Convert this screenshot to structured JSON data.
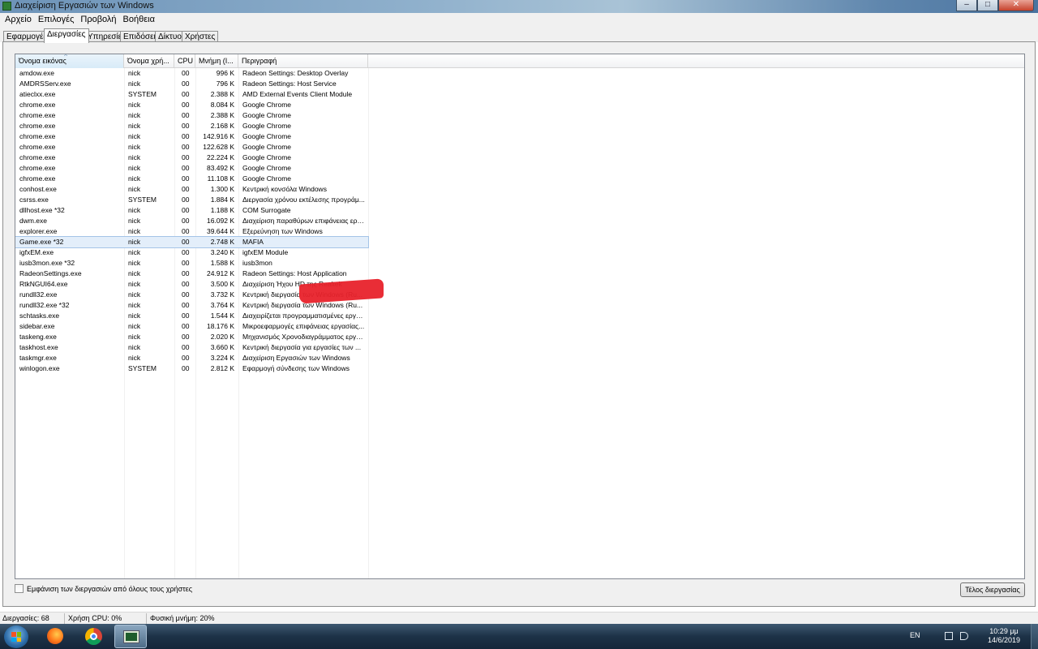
{
  "window": {
    "title": "Διαχείριση Εργασιών των Windows"
  },
  "menu": [
    "Αρχείο",
    "Επιλογές",
    "Προβολή",
    "Βοήθεια"
  ],
  "tabs": [
    "Εφαρμογές",
    "Διεργασίες",
    "Υπηρεσίες",
    "Επιδόσεις",
    "Δίκτυο",
    "Χρήστες"
  ],
  "active_tab": "Διεργασίες",
  "columns": {
    "image_name": "Όνομα εικόνας",
    "user_name": "Όνομα χρή...",
    "cpu": "CPU",
    "memory": "Μνήμη (Ι...",
    "description": "Περιγραφή"
  },
  "processes": [
    {
      "name": "amdow.exe",
      "user": "nick",
      "cpu": "00",
      "mem": "996 K",
      "desc": "Radeon Settings: Desktop Overlay"
    },
    {
      "name": "AMDRSServ.exe",
      "user": "nick",
      "cpu": "00",
      "mem": "796 K",
      "desc": "Radeon Settings: Host Service"
    },
    {
      "name": "atieclxx.exe",
      "user": "SYSTEM",
      "cpu": "00",
      "mem": "2.388 K",
      "desc": "AMD External Events Client Module"
    },
    {
      "name": "chrome.exe",
      "user": "nick",
      "cpu": "00",
      "mem": "8.084 K",
      "desc": "Google Chrome"
    },
    {
      "name": "chrome.exe",
      "user": "nick",
      "cpu": "00",
      "mem": "2.388 K",
      "desc": "Google Chrome"
    },
    {
      "name": "chrome.exe",
      "user": "nick",
      "cpu": "00",
      "mem": "2.168 K",
      "desc": "Google Chrome"
    },
    {
      "name": "chrome.exe",
      "user": "nick",
      "cpu": "00",
      "mem": "142.916 K",
      "desc": "Google Chrome"
    },
    {
      "name": "chrome.exe",
      "user": "nick",
      "cpu": "00",
      "mem": "122.628 K",
      "desc": "Google Chrome"
    },
    {
      "name": "chrome.exe",
      "user": "nick",
      "cpu": "00",
      "mem": "22.224 K",
      "desc": "Google Chrome"
    },
    {
      "name": "chrome.exe",
      "user": "nick",
      "cpu": "00",
      "mem": "83.492 K",
      "desc": "Google Chrome"
    },
    {
      "name": "chrome.exe",
      "user": "nick",
      "cpu": "00",
      "mem": "11.108 K",
      "desc": "Google Chrome"
    },
    {
      "name": "conhost.exe",
      "user": "nick",
      "cpu": "00",
      "mem": "1.300 K",
      "desc": "Κεντρική κονσόλα Windows"
    },
    {
      "name": "csrss.exe",
      "user": "SYSTEM",
      "cpu": "00",
      "mem": "1.884 K",
      "desc": "Διεργασία χρόνου εκτέλεσης προγράμ..."
    },
    {
      "name": "dllhost.exe *32",
      "user": "nick",
      "cpu": "00",
      "mem": "1.188 K",
      "desc": "COM Surrogate"
    },
    {
      "name": "dwm.exe",
      "user": "nick",
      "cpu": "00",
      "mem": "16.092 K",
      "desc": "Διαχείριση παραθύρων επιφάνειας εργ..."
    },
    {
      "name": "explorer.exe",
      "user": "nick",
      "cpu": "00",
      "mem": "39.644 K",
      "desc": "Εξερεύνηση των Windows"
    },
    {
      "name": "Game.exe *32",
      "user": "nick",
      "cpu": "00",
      "mem": "2.748 K",
      "desc": "MAFIA",
      "selected": true
    },
    {
      "name": "igfxEM.exe",
      "user": "nick",
      "cpu": "00",
      "mem": "3.240 K",
      "desc": "igfxEM Module"
    },
    {
      "name": "iusb3mon.exe *32",
      "user": "nick",
      "cpu": "00",
      "mem": "1.588 K",
      "desc": "iusb3mon"
    },
    {
      "name": "RadeonSettings.exe",
      "user": "nick",
      "cpu": "00",
      "mem": "24.912 K",
      "desc": "Radeon Settings: Host Application"
    },
    {
      "name": "RtkNGUI64.exe",
      "user": "nick",
      "cpu": "00",
      "mem": "3.500 K",
      "desc": "Διαχείριση Ήχου HD της Realtek"
    },
    {
      "name": "rundll32.exe",
      "user": "nick",
      "cpu": "00",
      "mem": "3.732 K",
      "desc": "Κεντρική διεργασία των Windows (Ru..."
    },
    {
      "name": "rundll32.exe *32",
      "user": "nick",
      "cpu": "00",
      "mem": "3.764 K",
      "desc": "Κεντρική διεργασία των Windows (Ru..."
    },
    {
      "name": "schtasks.exe",
      "user": "nick",
      "cpu": "00",
      "mem": "1.544 K",
      "desc": "Διαχειρίζεται προγραμματισμένες εργασ..."
    },
    {
      "name": "sidebar.exe",
      "user": "nick",
      "cpu": "00",
      "mem": "18.176 K",
      "desc": "Μικροεφαρμογές επιφάνειας εργασίας..."
    },
    {
      "name": "taskeng.exe",
      "user": "nick",
      "cpu": "00",
      "mem": "2.020 K",
      "desc": "Μηχανισμός Χρονοδιαγράμματος εργα..."
    },
    {
      "name": "taskhost.exe",
      "user": "nick",
      "cpu": "00",
      "mem": "3.660 K",
      "desc": "Κεντρική διεργασία για εργασίες των ..."
    },
    {
      "name": "taskmgr.exe",
      "user": "nick",
      "cpu": "00",
      "mem": "3.224 K",
      "desc": "Διαχείριση Εργασιών των Windows"
    },
    {
      "name": "winlogon.exe",
      "user": "SYSTEM",
      "cpu": "00",
      "mem": "2.812 K",
      "desc": "Εφαρμογή σύνδεσης των Windows"
    }
  ],
  "show_all_label": "Εμφάνιση των διεργασιών από όλους τους χρήστες",
  "end_process_label": "Τέλος διεργασίας",
  "status": {
    "processes": "Διεργασίες: 68",
    "cpu": "Χρήση CPU: 0%",
    "memory": "Φυσική μνήμη: 20%"
  },
  "taskbar": {
    "language": "EN",
    "time": "10:29 μμ",
    "date": "14/6/2019",
    "apps": [
      "firefox-icon",
      "chrome-icon",
      "task-manager-icon"
    ]
  },
  "colors": {
    "redaction": "#e8222b",
    "selection": "#e3eefa"
  }
}
